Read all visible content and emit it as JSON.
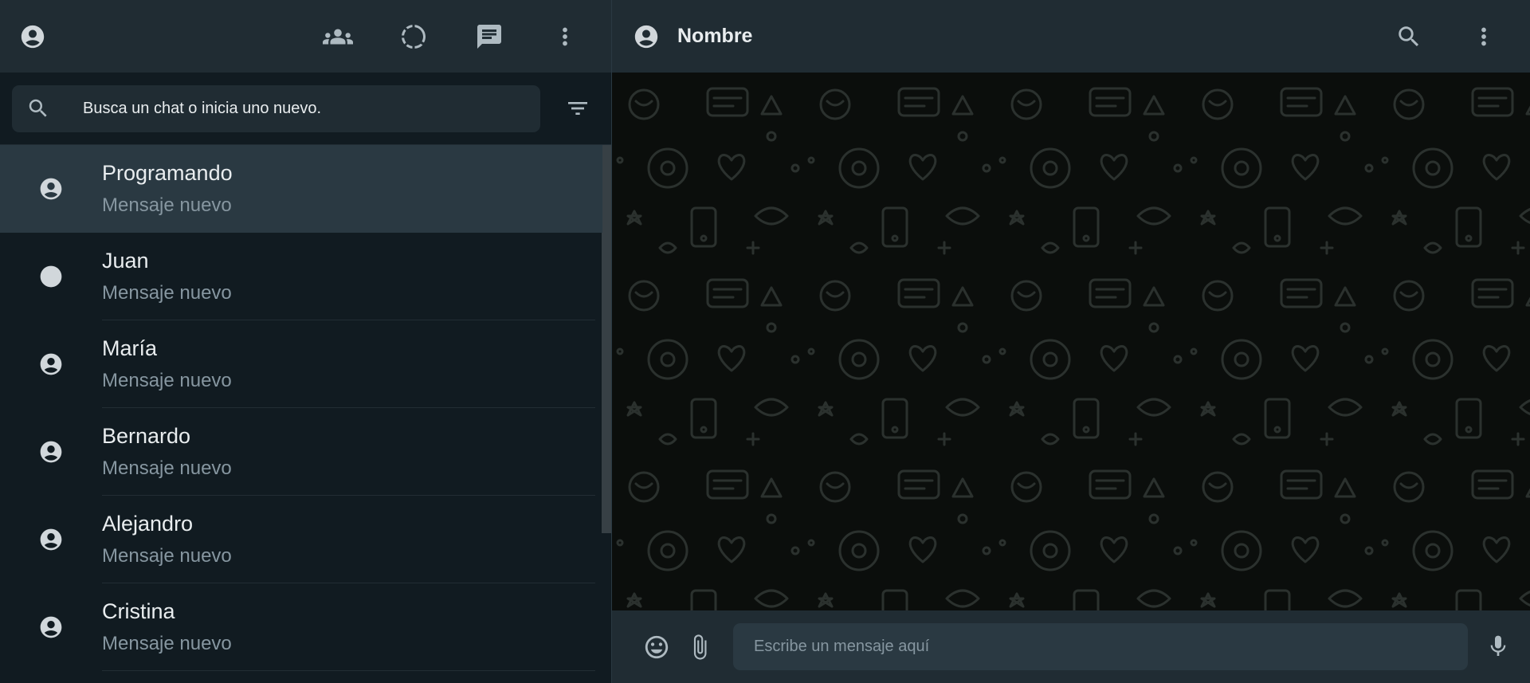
{
  "sidebar": {
    "header": {
      "icons": [
        "user-avatar-icon",
        "community-icon",
        "status-icon",
        "new-chat-icon",
        "menu-icon"
      ]
    },
    "search": {
      "placeholder": "Busca un chat o inicia uno nuevo."
    },
    "chats": [
      {
        "name": "Programando",
        "preview": "Mensaje nuevo"
      },
      {
        "name": "Juan",
        "preview": "Mensaje nuevo"
      },
      {
        "name": "María",
        "preview": "Mensaje nuevo"
      },
      {
        "name": "Bernardo",
        "preview": "Mensaje nuevo"
      },
      {
        "name": "Alejandro",
        "preview": "Mensaje nuevo"
      },
      {
        "name": "Cristina",
        "preview": "Mensaje nuevo"
      }
    ]
  },
  "conversation": {
    "header": {
      "contact_name": "Nombre"
    },
    "composer": {
      "placeholder": "Escribe un mensaje aquí"
    }
  },
  "colors": {
    "panel": "#202c33",
    "background": "#111b21",
    "active_chat": "#2a3942",
    "primary_text": "#e9edef",
    "secondary_text": "#8696a0",
    "icon": "#aebac1",
    "wallpaper": "#0b0e0c"
  }
}
